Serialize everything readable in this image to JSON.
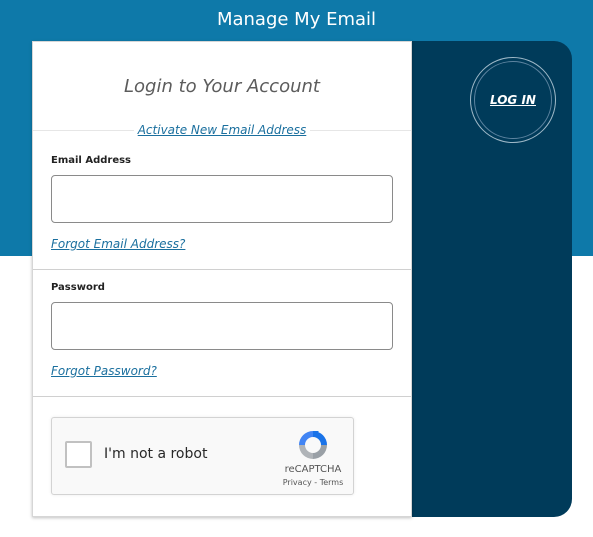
{
  "header": {
    "title": "Manage My Email"
  },
  "side": {
    "login_label": "LOG IN"
  },
  "card": {
    "title": "Login to Your Account",
    "activate_link": "Activate New Email Address",
    "email": {
      "label": "Email Address",
      "value": "",
      "forgot_link": "Forgot Email Address?"
    },
    "password": {
      "label": "Password",
      "value": "",
      "forgot_link": "Forgot Password?"
    }
  },
  "recaptcha": {
    "checkbox_label": "I'm not a robot",
    "brand": "reCAPTCHA",
    "privacy": "Privacy",
    "separator": " - ",
    "terms": "Terms",
    "checked": false
  },
  "colors": {
    "accent": "#0e79a9",
    "panel": "#003b5a",
    "link": "#1a6f9e"
  }
}
